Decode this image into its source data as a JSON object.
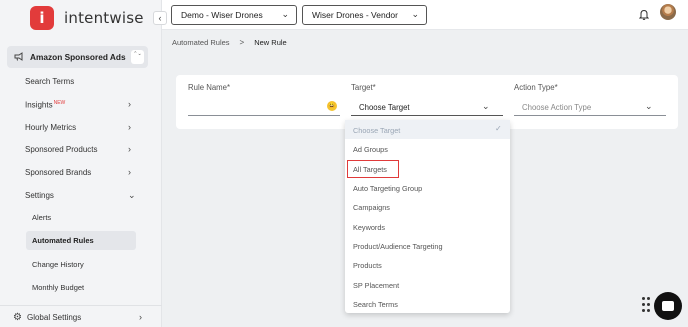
{
  "brand": {
    "mark": "i",
    "name": "intentwise"
  },
  "sidebar": {
    "product": {
      "label": "Amazon Sponsored Ads",
      "stepper": "⌃⌄"
    },
    "items": [
      {
        "label": "Search Terms"
      },
      {
        "label": "Insights",
        "badge": "NEW"
      },
      {
        "label": "Hourly Metrics"
      },
      {
        "label": "Sponsored Products"
      },
      {
        "label": "Sponsored Brands"
      },
      {
        "label": "Settings"
      }
    ],
    "settings_children": [
      {
        "label": "Alerts"
      },
      {
        "label": "Automated Rules"
      },
      {
        "label": "Change History"
      },
      {
        "label": "Monthly Budget"
      }
    ],
    "global_settings": "Global Settings"
  },
  "topbar": {
    "account_select": "Demo - Wiser Drones",
    "profile_select": "Wiser Drones - Vendor"
  },
  "breadcrumb": {
    "parent": "Automated Rules",
    "separator": ">",
    "current": "New Rule"
  },
  "form": {
    "rule_name_label": "Rule Name*",
    "rule_name_value": "",
    "emoji": "😀",
    "target_label": "Target*",
    "target_value": "Choose Target",
    "action_label": "Action Type*",
    "action_placeholder": "Choose Action Type"
  },
  "target_dropdown": {
    "options": [
      "Choose Target",
      "Ad Groups",
      "All Targets",
      "Auto Targeting Group",
      "Campaigns",
      "Keywords",
      "Product/Audience Targeting",
      "Products",
      "SP Placement",
      "Search Terms"
    ],
    "selected": "Choose Target",
    "highlighted": "All Targets"
  },
  "icons": {
    "collapse": "chevron-left-icon",
    "megaphone": "megaphone-icon",
    "gear": "gear-icon",
    "bell": "bell-icon",
    "chat": "chat-icon",
    "grip": "grip-icon"
  },
  "colors": {
    "brand": "#e23b3b",
    "highlight": "#e03a3a",
    "selected_text": "#9aa6b5"
  }
}
